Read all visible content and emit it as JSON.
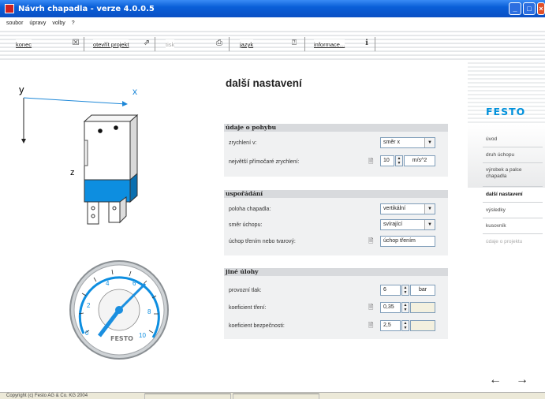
{
  "window": {
    "title": "Návrh chapadla - verze 4.0.0.5",
    "controls": [
      "minimize-icon",
      "maximize-icon",
      "close-icon"
    ]
  },
  "menu": [
    "soubor",
    "úpravy",
    "volby",
    "?"
  ],
  "toolbar": {
    "konec": "konec",
    "otevrit": "otevřít projekt",
    "tisk": "tisk",
    "jazyk": "jazyk",
    "informace": "informace..."
  },
  "diagram": {
    "axis_x": "x",
    "axis_y": "y",
    "axis_z": "z"
  },
  "gauge": {
    "brand": "FESTO"
  },
  "page_title": "další nastavení",
  "sections": {
    "pohyb": {
      "title": "údaje o pohybu",
      "zrychleni_label": "zrychlení v:",
      "zrychleni_value": "směr x",
      "max_label": "největší přímočaré zrychlení:",
      "max_value": "10",
      "max_unit": "m/s^2"
    },
    "usporadani": {
      "title": "uspořádání",
      "poloha_label": "poloha chapadla:",
      "poloha_value": "vertikální",
      "smer_label": "směr úchopu:",
      "smer_value": "svírající",
      "uchop_label": "úchop třením nebo tvarový:",
      "uchop_value": "úchop třením"
    },
    "jine": {
      "title": "jiné úlohy",
      "tlak_label": "provozní tlak:",
      "tlak_value": "6",
      "tlak_unit": "bar",
      "treni_label": "koeficient tření:",
      "treni_value": "0,35",
      "bezpecnost_label": "koeficient bezpečnosti:",
      "bezpecnost_value": "2,5"
    }
  },
  "sidebar": {
    "logo": "FESTO",
    "items": [
      {
        "label": "úvod",
        "state": "normal"
      },
      {
        "label": "druh úchopu",
        "state": "normal"
      },
      {
        "label": "výrobek a palce chapadla",
        "state": "normal"
      },
      {
        "label": "další nastavení",
        "state": "active"
      },
      {
        "label": "výsledky",
        "state": "normal"
      },
      {
        "label": "kusovník",
        "state": "normal"
      },
      {
        "label": "údaje o projektu",
        "state": "disabled"
      }
    ],
    "back": "←",
    "forward": "→"
  },
  "statusbar": {
    "copyright": "Copyright (c) Festo AG & Co. KG 2004"
  },
  "colors": {
    "accent": "#0091dc",
    "titlebar": "#0a5fd8",
    "section_header": "#d8dadd"
  }
}
